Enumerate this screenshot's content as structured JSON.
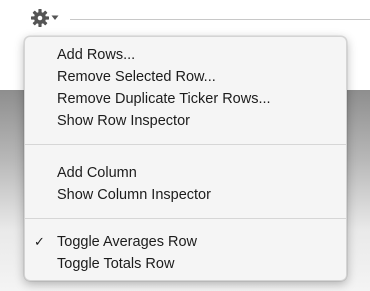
{
  "toolbar": {
    "action_button_icon": "gear-icon",
    "dropdown_icon": "chevron-down-icon"
  },
  "menu": {
    "group1": [
      {
        "label": "Add Rows..."
      },
      {
        "label": "Remove Selected Row..."
      },
      {
        "label": "Remove Duplicate Ticker Rows..."
      },
      {
        "label": "Show Row Inspector"
      }
    ],
    "group2": [
      {
        "label": "Add Column"
      },
      {
        "label": "Show Column Inspector"
      }
    ],
    "group3": [
      {
        "label": "Toggle Averages Row",
        "checked": true,
        "check_mark": "✓"
      },
      {
        "label": "Toggle Totals Row",
        "checked": false
      }
    ]
  }
}
